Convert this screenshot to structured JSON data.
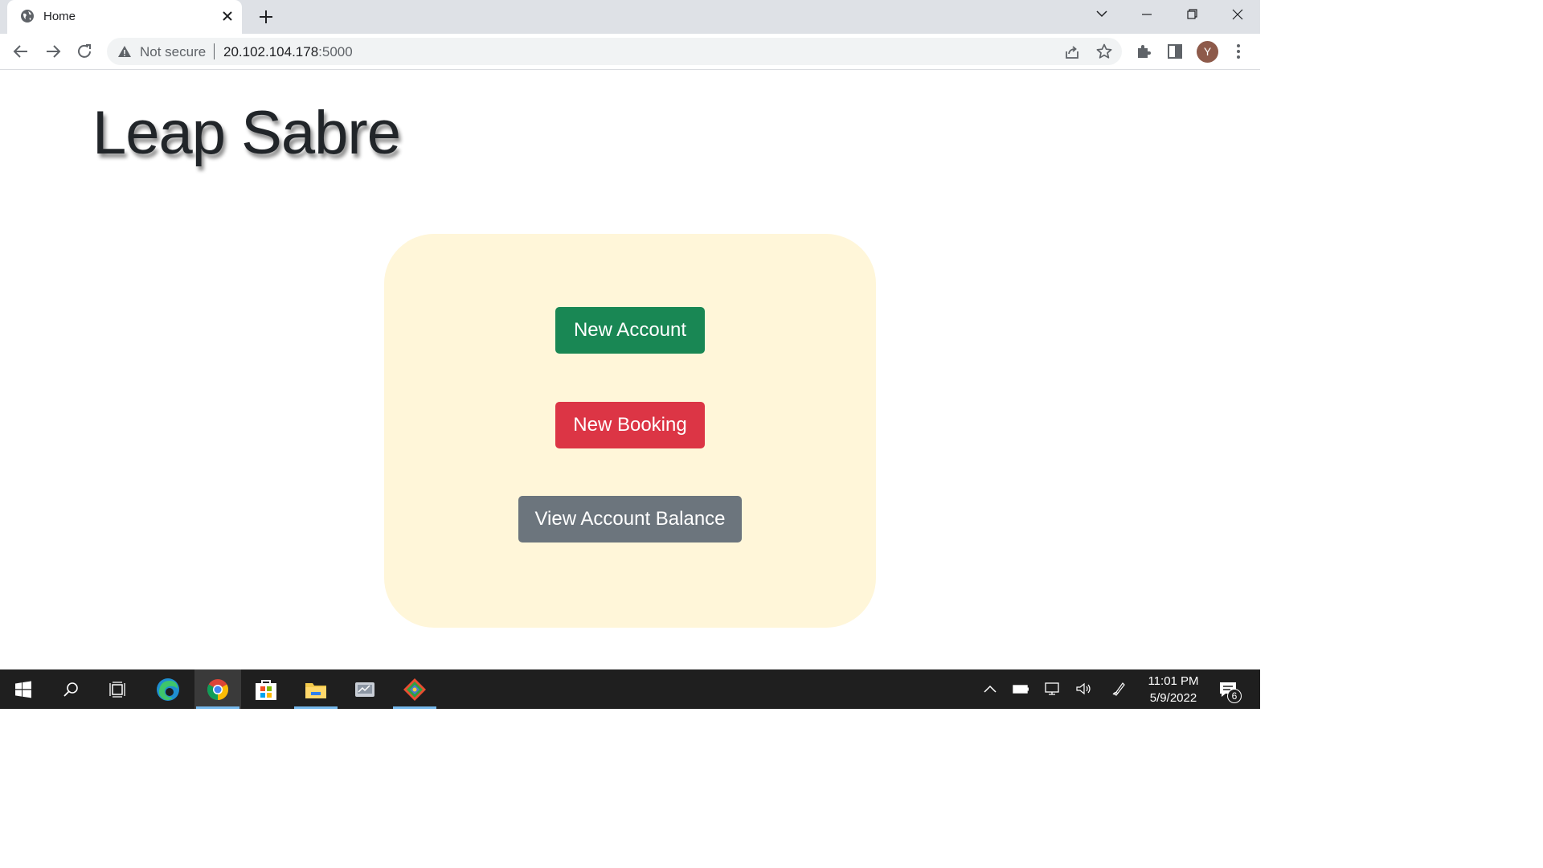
{
  "browser": {
    "tab": {
      "title": "Home"
    },
    "omnibox": {
      "security_label": "Not secure",
      "host": "20.102.104.178",
      "port": ":5000"
    },
    "profile_initial": "Y"
  },
  "page": {
    "title": "Leap Sabre",
    "buttons": {
      "new_account": "New Account",
      "new_booking": "New Booking",
      "view_balance": "View Account Balance"
    }
  },
  "taskbar": {
    "time": "11:01 PM",
    "date": "5/9/2022",
    "notification_count": "6"
  },
  "colors": {
    "panel_bg": "#fff6d9",
    "success": "#198754",
    "danger": "#dc3545",
    "secondary": "#6c757d"
  }
}
